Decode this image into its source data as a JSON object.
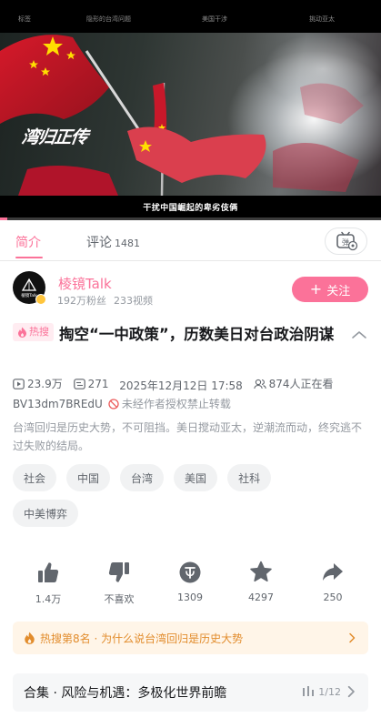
{
  "player": {
    "top_labels": [
      "标签",
      "隐形的台湾问题",
      "美国干涉",
      "挑动亚太"
    ],
    "logo_text": "湾归正传",
    "caption": "干扰中国崛起的卑劣伎俩",
    "progress": 0.02
  },
  "tabs": {
    "intro_label": "简介",
    "comments_label": "评论",
    "comments_count": "1481",
    "danmaku_icon": "danmaku-toggle-icon"
  },
  "uploader": {
    "name": "棱镜Talk",
    "avatar_text": "棱镜Talk",
    "fans": "192万粉丝",
    "videos": "233视频",
    "follow_label": "关注"
  },
  "video": {
    "hot_tag": "热搜",
    "title": "掏空“一中政策”，历数美日对台政治阴谋",
    "views": "23.9万",
    "danmaku": "271",
    "date": "2025年12月12日 17:58",
    "watching": "874人正在看",
    "bvid": "BV13dm7BREdU",
    "copyright": "未经作者授权禁止转载",
    "description": "台湾回归是历史大势，不可阻挡。美日搅动亚太，逆潮流而动，终究逃不过失败的结局。"
  },
  "tags": {
    "row1": [
      "社会",
      "中国",
      "台湾",
      "美国",
      "社科"
    ],
    "row2": [
      "中美博弈"
    ]
  },
  "actions": {
    "like": "1.4万",
    "dislike": "不喜欢",
    "coin": "1309",
    "favorite": "4297",
    "share": "250"
  },
  "hot_search": {
    "text": "热搜第8名 · 为什么说台湾回归是历史大势"
  },
  "collection": {
    "name": "合集 · 风险与机遇：多极化世界前瞻",
    "progress": "1/12"
  },
  "colors": {
    "accent": "#fb7299",
    "hot_orange": "#e28c2c",
    "text_secondary": "#61666d",
    "text_muted": "#9499a0"
  }
}
